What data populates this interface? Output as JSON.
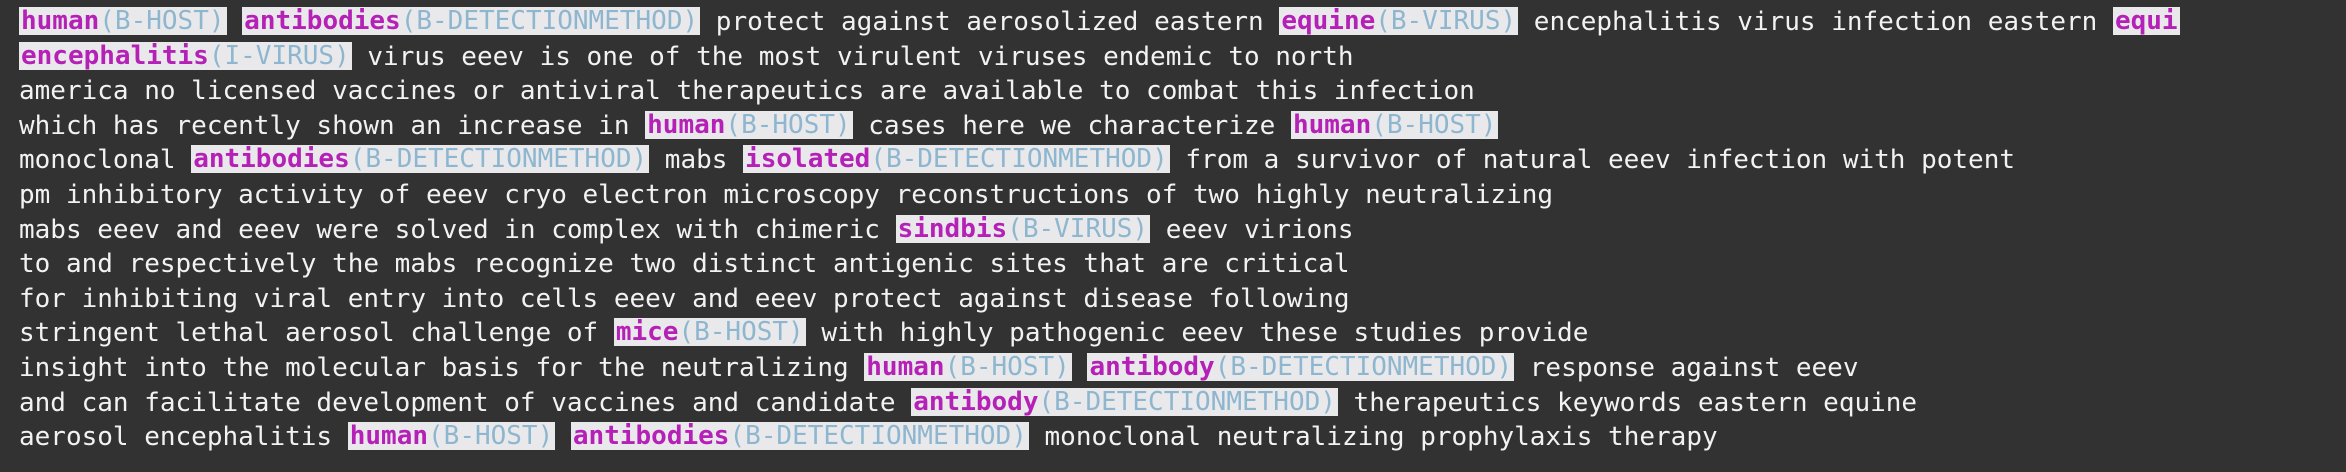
{
  "lines": [
    [
      {
        "w": "human",
        "l": "(B-HOST)"
      },
      " ",
      {
        "w": "antibodies",
        "l": "(B-DETECTIONMETHOD)"
      },
      " protect against aerosolized eastern ",
      {
        "w": "equine",
        "l": "(B-VIRUS)"
      },
      " encephalitis virus infection eastern ",
      {
        "w": "equi",
        "l": ""
      }
    ],
    [
      {
        "w": "encephalitis",
        "l": "(I-VIRUS)"
      },
      " virus eeev is one of the most virulent viruses endemic to north"
    ],
    [
      "america no licensed vaccines or antiviral therapeutics are available to combat this infection"
    ],
    [
      "which has recently shown an increase in ",
      {
        "w": "human",
        "l": "(B-HOST)"
      },
      " cases here we characterize ",
      {
        "w": "human",
        "l": "(B-HOST)"
      }
    ],
    [
      "monoclonal ",
      {
        "w": "antibodies",
        "l": "(B-DETECTIONMETHOD)"
      },
      " mabs ",
      {
        "w": "isolated",
        "l": "(B-DETECTIONMETHOD)"
      },
      " from a survivor of natural eeev infection with potent"
    ],
    [
      "pm inhibitory activity of eeev cryo electron microscopy reconstructions of two highly neutralizing"
    ],
    [
      "mabs eeev and eeev were solved in complex with chimeric ",
      {
        "w": "sindbis",
        "l": "(B-VIRUS)"
      },
      " eeev virions"
    ],
    [
      "to and respectively the mabs recognize two distinct antigenic sites that are critical"
    ],
    [
      "for inhibiting viral entry into cells eeev and eeev protect against disease following"
    ],
    [
      "stringent lethal aerosol challenge of ",
      {
        "w": "mice",
        "l": "(B-HOST)"
      },
      " with highly pathogenic eeev these studies provide"
    ],
    [
      "insight into the molecular basis for the neutralizing ",
      {
        "w": "human",
        "l": "(B-HOST)"
      },
      " ",
      {
        "w": "antibody",
        "l": "(B-DETECTIONMETHOD)"
      },
      " response against eeev"
    ],
    [
      "and can facilitate development of vaccines and candidate ",
      {
        "w": "antibody",
        "l": "(B-DETECTIONMETHOD)"
      },
      " therapeutics keywords eastern equine"
    ],
    [
      "aerosol encephalitis ",
      {
        "w": "human",
        "l": "(B-HOST)"
      },
      " ",
      {
        "w": "antibodies",
        "l": "(B-DETECTIONMETHOD)"
      },
      " monoclonal neutralizing prophylaxis therapy"
    ]
  ]
}
